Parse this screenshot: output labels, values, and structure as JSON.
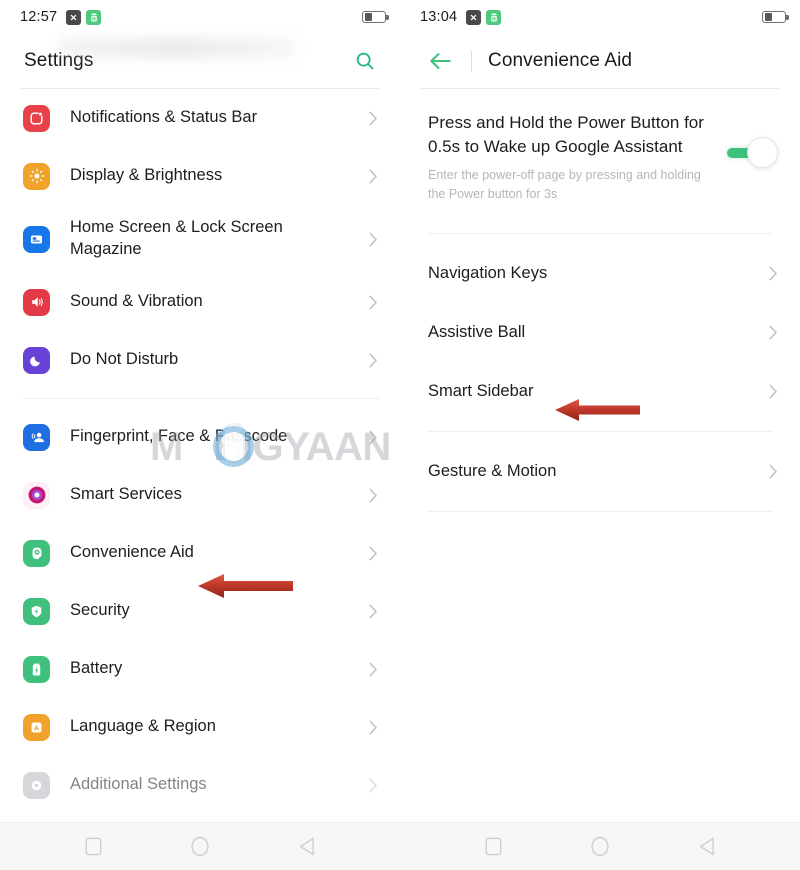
{
  "left_screen": {
    "status_bar": {
      "time": "12:57",
      "icons": [
        "close-badge-icon",
        "green-app-icon"
      ],
      "battery_level": 40
    },
    "app_bar": {
      "title": "Settings",
      "search_icon": "search-icon"
    },
    "items": [
      {
        "label": "Notifications & Status Bar",
        "icon": "notifications-icon",
        "color": "#e8414a",
        "chevron": "chevron-right-icon"
      },
      {
        "label": "Display & Brightness",
        "icon": "brightness-icon",
        "color": "#f0a32a",
        "chevron": "chevron-right-icon"
      },
      {
        "label": "Home Screen & Lock Screen Magazine",
        "icon": "home-screen-icon",
        "color": "#1877e8",
        "chevron": "chevron-right-icon"
      },
      {
        "label": "Sound & Vibration",
        "icon": "sound-icon",
        "color": "#e23a47",
        "chevron": "chevron-right-icon"
      },
      {
        "label": "Do Not Disturb",
        "icon": "moon-icon",
        "color": "#6842d6",
        "chevron": "chevron-right-icon"
      },
      {
        "label": "Fingerprint, Face & Passcode",
        "icon": "fingerprint-face-icon",
        "color": "#1f6fe0",
        "chevron": "chevron-right-icon"
      },
      {
        "label": "Smart Services",
        "icon": "smart-services-icon",
        "color": "#ffffff",
        "chevron": "chevron-right-icon"
      },
      {
        "label": "Convenience Aid",
        "icon": "convenience-aid-icon",
        "color": "#3fc07d",
        "chevron": "chevron-right-icon"
      },
      {
        "label": "Security",
        "icon": "shield-icon",
        "color": "#3fc07d",
        "chevron": "chevron-right-icon"
      },
      {
        "label": "Battery",
        "icon": "battery-icon",
        "color": "#3fc07d",
        "chevron": "chevron-right-icon"
      },
      {
        "label": "Language & Region",
        "icon": "language-icon",
        "color": "#f0a32a",
        "chevron": "chevron-right-icon"
      },
      {
        "label": "Additional Settings",
        "icon": "additional-settings-icon",
        "color": "#b4b8bd",
        "chevron": "chevron-right-icon"
      }
    ],
    "arrow_target": "Convenience Aid"
  },
  "right_screen": {
    "status_bar": {
      "time": "13:04",
      "icons": [
        "close-badge-icon",
        "green-app-icon"
      ],
      "battery_level": 40
    },
    "app_bar": {
      "back_icon": "back-arrow-icon",
      "title": "Convenience Aid"
    },
    "power_button_setting": {
      "title": "Press and Hold the Power Button for 0.5s to Wake up Google Assistant",
      "subtitle": "Enter the power-off page by pressing and holding the Power button for 3s",
      "toggle_state": "on",
      "toggle_color": "#3dc17d"
    },
    "items": [
      {
        "label": "Navigation Keys",
        "chevron": "chevron-right-icon"
      },
      {
        "label": "Assistive Ball",
        "chevron": "chevron-right-icon"
      },
      {
        "label": "Smart Sidebar",
        "chevron": "chevron-right-icon"
      },
      {
        "label": "Gesture & Motion",
        "chevron": "chevron-right-icon"
      }
    ],
    "arrow_target": "Smart Sidebar"
  },
  "nav_bar": {
    "buttons": [
      "recents-square-icon",
      "home-circle-icon",
      "back-triangle-icon"
    ]
  },
  "watermark": {
    "text_before": "M",
    "text_after": "BIGYAAN",
    "color": "#969ba2"
  },
  "annotation": {
    "arrow_color": "#c0392b"
  }
}
